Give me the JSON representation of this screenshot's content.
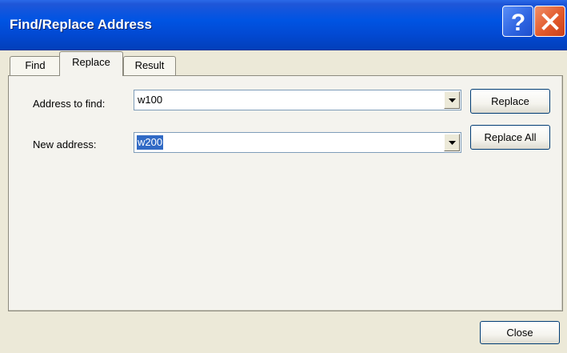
{
  "window": {
    "title": "Find/Replace Address",
    "help_icon": "question-mark-icon",
    "close_icon": "close-x-icon"
  },
  "tabs": [
    {
      "label": "Find",
      "selected": false
    },
    {
      "label": "Replace",
      "selected": true
    },
    {
      "label": "Result",
      "selected": false
    }
  ],
  "form": {
    "address_to_find_label": "Address to find:",
    "address_to_find_value": "w100",
    "new_address_label": "New address:",
    "new_address_value": "w200"
  },
  "buttons": {
    "replace": "Replace",
    "replace_all": "Replace All",
    "close": "Close"
  },
  "colors": {
    "titlebar": "#0054e3",
    "selection": "#316ac5",
    "close_button": "#e25a2c"
  }
}
